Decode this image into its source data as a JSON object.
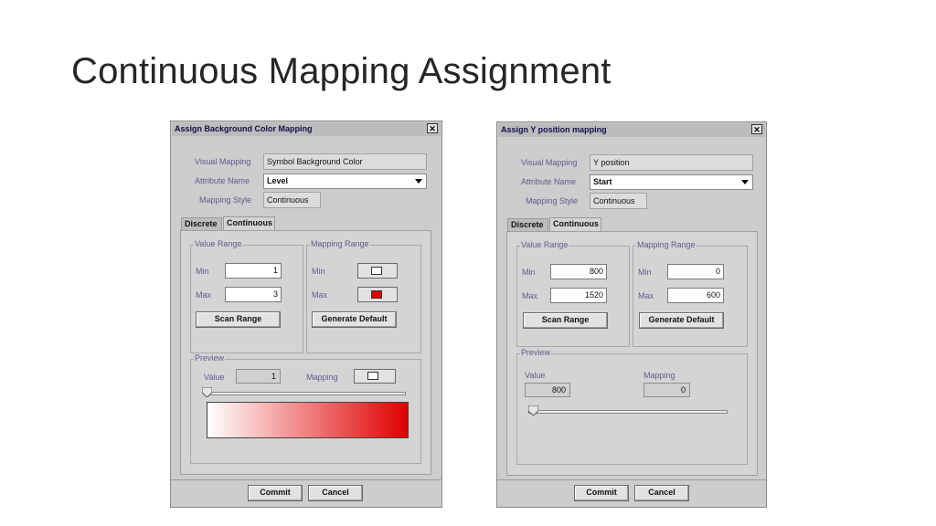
{
  "slide": {
    "title": "Continuous Mapping Assignment"
  },
  "dialog_bg": {
    "title": "Assign Background Color Mapping",
    "close": "✕",
    "labels": {
      "visual_mapping": "Visual Mapping",
      "attribute_name": "Attribute Name",
      "mapping_style": "Mapping Style"
    },
    "visual_mapping_value": "Symbol Background Color",
    "attribute_value": "Level",
    "mapping_style_value": "Continuous",
    "tabs": [
      "Discrete",
      "Continuous"
    ],
    "value_range": {
      "legend": "Value Range",
      "min_label": "Min",
      "max_label": "Max",
      "min": "1",
      "max": "3",
      "scan": "Scan Range"
    },
    "mapping_range": {
      "legend": "Mapping Range",
      "min_label": "Min",
      "max_label": "Max",
      "min_color": "#ffffff",
      "max_color": "#e00000",
      "generate": "Generate Default"
    },
    "preview": {
      "legend": "Preview",
      "value_label": "Value",
      "value": "1",
      "mapping_label": "Mapping",
      "mapping_color": "#ffffff",
      "slider_fraction": 0
    },
    "commit": "Commit",
    "cancel": "Cancel"
  },
  "dialog_y": {
    "title": "Assign Y position mapping",
    "close": "✕",
    "labels": {
      "visual_mapping": "Visual Mapping",
      "attribute_name": "Attribute Name",
      "mapping_style": "Mapping Style"
    },
    "visual_mapping_value": "Y position",
    "attribute_value": "Start",
    "mapping_style_value": "Continuous",
    "tabs": [
      "Discrete",
      "Continuous"
    ],
    "value_range": {
      "legend": "Value Range",
      "min_label": "Min",
      "max_label": "Max",
      "min": "800",
      "max": "1520",
      "scan": "Scan Range"
    },
    "mapping_range": {
      "legend": "Mapping Range",
      "min_label": "Min",
      "max_label": "Max",
      "min": "0",
      "max": "600",
      "generate": "Generate Default"
    },
    "preview": {
      "legend": "Preview",
      "value_label": "Value",
      "value": "800",
      "mapping_label": "Mapping",
      "mapping": "0",
      "slider_fraction": 0
    },
    "commit": "Commit",
    "cancel": "Cancel"
  }
}
